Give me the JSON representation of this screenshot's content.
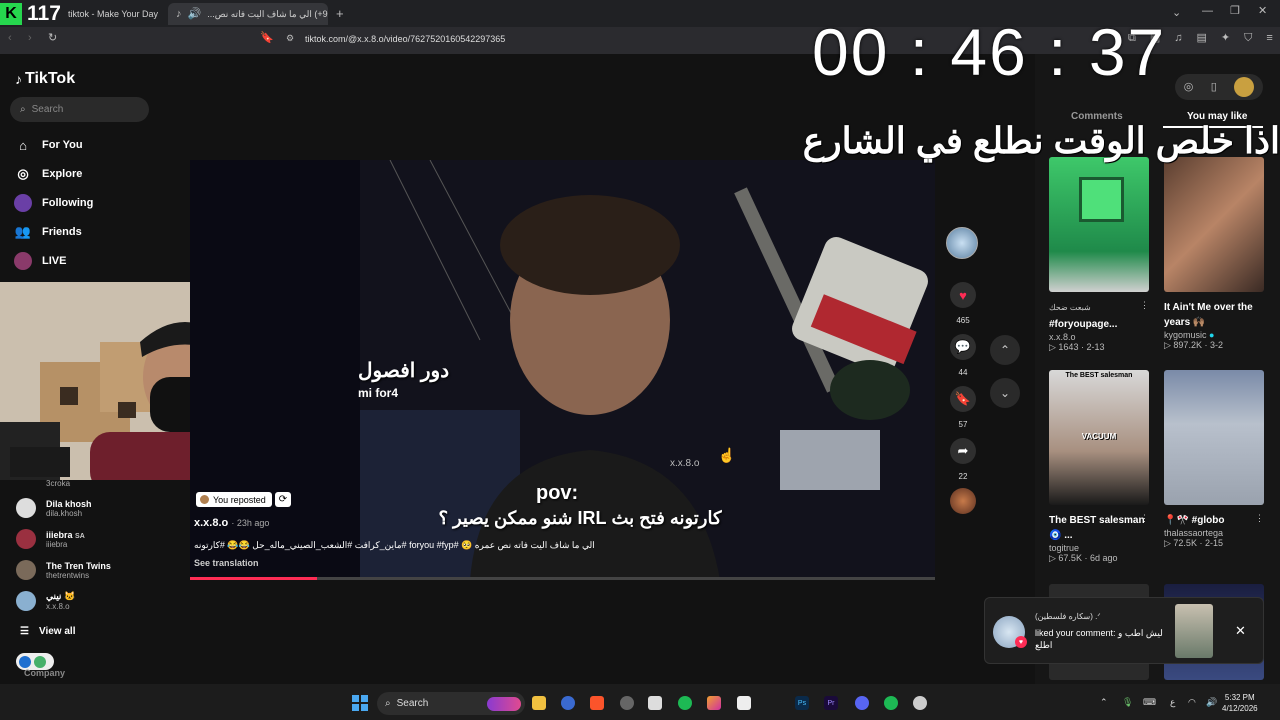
{
  "overlay": {
    "counter_badge": "K",
    "counter": "117",
    "timer": "00 : 46 : 37",
    "text": "اذا خلص الوقت نطلع في الشارع"
  },
  "browser": {
    "tabs": [
      {
        "title": "tiktok - Make Your Day"
      },
      {
        "title": "(99+) الي ما شاف اليت فاته نص...",
        "active": true
      }
    ],
    "new_tab": "+",
    "url": "tiktok.com/@x.x.8.o/video/7627520160542297365"
  },
  "sidebar": {
    "logo": "TikTok",
    "search_placeholder": "Search",
    "nav": [
      {
        "label": "For You",
        "icon": "home-icon"
      },
      {
        "label": "Explore",
        "icon": "compass-icon"
      },
      {
        "label": "Following",
        "icon": "following-icon"
      },
      {
        "label": "Friends",
        "icon": "friends-icon"
      },
      {
        "label": "LIVE",
        "icon": "live-icon"
      }
    ],
    "accounts": [
      {
        "name": "Dila khosh",
        "handle": "dila.khosh"
      },
      {
        "name": "iiiebra",
        "handle": "iiiebra",
        "suffix": "SA"
      },
      {
        "name": "The Tren Twins",
        "handle": "thetrentwins"
      },
      {
        "name": "نيني 🐱",
        "handle": "x.x.8.o"
      }
    ],
    "partial_handle": "3croka",
    "view_all": "View all",
    "company": "Company"
  },
  "video": {
    "pov": "pov:",
    "caption": "كارتونه فتح بث IRL شنو ممكن يصير ؟",
    "sign": "دور افصول",
    "sign2": "mi for4",
    "watermark": "x.x.8.o",
    "progress": 0.17
  },
  "info": {
    "reposted": "You reposted",
    "author": "x.x.8.o",
    "time": "23h ago",
    "description": "الي ما شاف اليت فاته نص عمره 🥺 #foryou #fyp #ماين_كرافت #الشعب_الصيني_ماله_حل 😂😂 #كارتونه",
    "see_translation": "See translation"
  },
  "actions": {
    "likes": "465",
    "comments": "44",
    "saves": "57",
    "shares": "22"
  },
  "right_panel": {
    "tabs": [
      "Comments",
      "You may like"
    ],
    "cards": [
      {
        "title": "#foryoupage...",
        "subtitle": "شبعت ضحك",
        "author": "x.x.8.o",
        "views": "1643",
        "date": "2-13"
      },
      {
        "title": "It Ain't Me over the years 🙌🏽",
        "author": "kygomusic",
        "views": "897.2K",
        "date": "3-2"
      },
      {
        "title": "The BEST salesman🧿 ...",
        "author": "togitrue",
        "views": "67.5K",
        "date": "6d ago",
        "thumb_label": "The BEST salesman",
        "thumb_label2": "VACUUM"
      },
      {
        "title": "📍🎌 #globo",
        "author": "thalassaortega",
        "views": "72.5K",
        "date": "2-15"
      }
    ]
  },
  "notification": {
    "name": "(سكاره فلسطين) .ᐟ",
    "text": "liked your comment: ليش اطب و اطلع"
  },
  "taskbar": {
    "search": "Search",
    "time": "5:32 PM",
    "date": "4/12/2026",
    "lang": "ع"
  }
}
